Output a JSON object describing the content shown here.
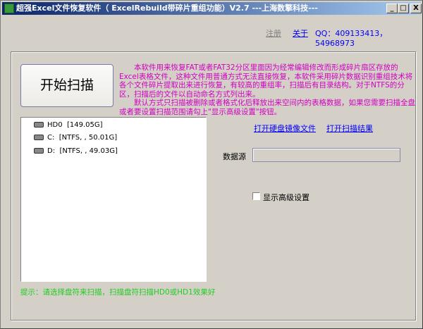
{
  "window": {
    "title": "超强Excel文件恢复软件（ ExcelRebuild带碎片重组功能）V2.7  ---上海数擎科技---",
    "min": "_",
    "max": "□",
    "close": "X"
  },
  "header": {
    "register": "注册",
    "about": "关于",
    "qq": "QQ：409133413，54968973"
  },
  "scan_button": "开始扫描",
  "description": [
    "　　本软件用来恢复FAT或者FAT32分区里面因为经常编辑修改而形成碎片扇区存放的Excel表格文件，这种文件用普通方式无法直接恢复，本软件采用碎片数据识别重组技术将各个文件碎片提取出来进行恢复，有较高的重组率，扫描后有目录结构。对于NTFS的分区，扫描后的文件以自动命名方式列出来。",
    "　　默认方式只扫描被删除或者格式化后释放出来空间内的表格数据，如果您需要扫描全盘或者要设置扫描范围请勾上\"显示高级设置\"按钮。"
  ],
  "tree": [
    {
      "name": "HD0",
      "info": "[149.05G]"
    },
    {
      "name": "C:",
      "info": "[NTFS, , 50.01G]"
    },
    {
      "name": "D:",
      "info": "[NTFS, , 49.03G]"
    }
  ],
  "links": {
    "open_image": "打开硬盘镜像文件",
    "open_result": "打开扫描结果"
  },
  "datasource": {
    "label": "数据源",
    "value": ""
  },
  "advanced": {
    "label": "显示高级设置",
    "checked": false
  },
  "hint": "提示：请选择盘符来扫描，扫描盘符扫描HD0或HD1效果好"
}
